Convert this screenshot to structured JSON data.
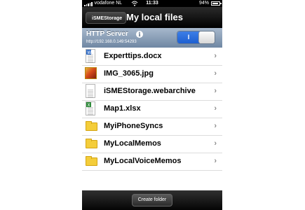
{
  "status_bar": {
    "carrier": "vodafone NL",
    "time": "11:33",
    "battery_percent": "94%",
    "battery_level": 0.94
  },
  "nav": {
    "back_label": "iSMEStorage",
    "title": "My local files"
  },
  "server": {
    "title": "HTTP Server",
    "url": "http://192.168.0.149:54293",
    "toggle_label": "I",
    "toggle_on": true
  },
  "files": [
    {
      "name": "Experttips.docx",
      "icon": "docx-file-icon",
      "type": "docx"
    },
    {
      "name": "IMG_3065.jpg",
      "icon": "image-file-icon",
      "type": "jpg"
    },
    {
      "name": "iSMEStorage.webarchive",
      "icon": "webarchive-file-icon",
      "type": "webarchive"
    },
    {
      "name": "Map1.xlsx",
      "icon": "xlsx-file-icon",
      "type": "xlsx"
    },
    {
      "name": "MyiPhoneSyncs",
      "icon": "folder-icon",
      "type": "folder"
    },
    {
      "name": "MyLocalMemos",
      "icon": "folder-icon",
      "type": "folder"
    },
    {
      "name": "MyLocalVoiceMemos",
      "icon": "folder-icon",
      "type": "folder"
    }
  ],
  "toolbar": {
    "create_folder_label": "Create folder"
  },
  "colors": {
    "server_bar": "#8fa3bb",
    "toggle_on": "#2b6fdc",
    "folder": "#f4cd3a"
  }
}
